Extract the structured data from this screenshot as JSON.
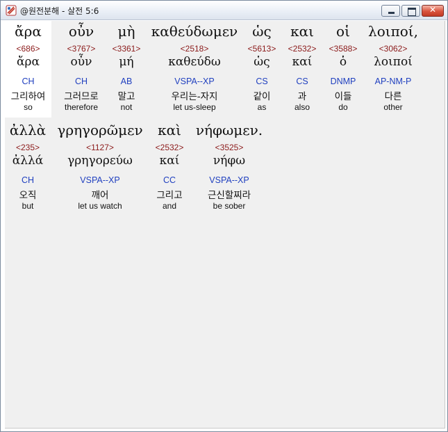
{
  "window": {
    "title": "@원전분해 - 살전 5:6"
  },
  "rows": [
    [
      {
        "greek": "ἄρα",
        "strong": "<686>",
        "lemma": "ἄρα",
        "parse": "CH",
        "korean": "그리하여",
        "english": "so",
        "selected": true
      },
      {
        "greek": "οὖν",
        "strong": "<3767>",
        "lemma": "οὖν",
        "parse": "CH",
        "korean": "그러므로",
        "english": "therefore"
      },
      {
        "greek": "μὴ",
        "strong": "<3361>",
        "lemma": "μή",
        "parse": "AB",
        "korean": "말고",
        "english": "not"
      },
      {
        "greek": "καθεύδωμεν",
        "strong": "<2518>",
        "lemma": "καθεύδω",
        "parse": "VSPA--XP",
        "korean": "우리는-자지",
        "english": "let us-sleep"
      },
      {
        "greek": "ὡς",
        "strong": "<5613>",
        "lemma": "ὡς",
        "parse": "CS",
        "korean": "같이",
        "english": "as"
      },
      {
        "greek": "και",
        "strong": "<2532>",
        "lemma": "καί",
        "parse": "CS",
        "korean": "과",
        "english": "also"
      },
      {
        "greek": "οἱ",
        "strong": "<3588>",
        "lemma": "ὁ",
        "parse": "DNMP",
        "korean": "이들",
        "english": "do"
      },
      {
        "greek": "λοιποί,",
        "strong": "<3062>",
        "lemma": "λοιποί",
        "parse": "AP-NM-P",
        "korean": "다른",
        "english": "other"
      }
    ],
    [
      {
        "greek": "ἀλλὰ",
        "strong": "<235>",
        "lemma": "ἀλλά",
        "parse": "CH",
        "korean": "오직",
        "english": "but"
      },
      {
        "greek": "γρηγορῶμεν",
        "strong": "<1127>",
        "lemma": "γρηγορεύω",
        "parse": "VSPA--XP",
        "korean": "깨어",
        "english": "let us watch"
      },
      {
        "greek": "καὶ",
        "strong": "<2532>",
        "lemma": "καί",
        "parse": "CC",
        "korean": "그리고",
        "english": "and"
      },
      {
        "greek": "νήφωμεν.",
        "strong": "<3525>",
        "lemma": "νήφω",
        "parse": "VSPA--XP",
        "korean": "근신할찌라",
        "english": "be sober"
      }
    ]
  ]
}
